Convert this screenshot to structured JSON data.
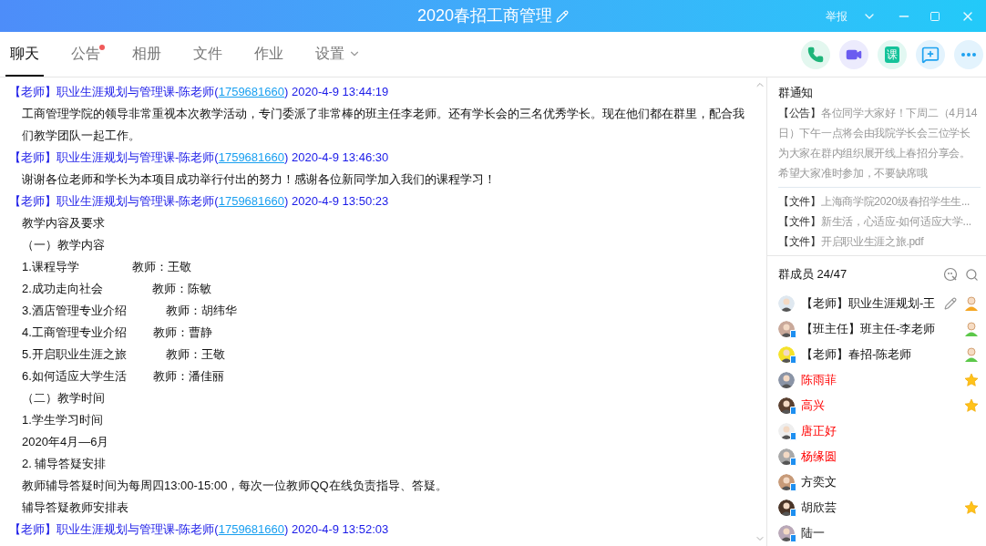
{
  "window": {
    "title": "2020春招工商管理",
    "report": "举报"
  },
  "tabs": [
    {
      "label": "聊天",
      "selected": true,
      "badge": false,
      "dropdown": false
    },
    {
      "label": "公告",
      "selected": false,
      "badge": true,
      "dropdown": false
    },
    {
      "label": "相册",
      "selected": false,
      "badge": false,
      "dropdown": false
    },
    {
      "label": "文件",
      "selected": false,
      "badge": false,
      "dropdown": false
    },
    {
      "label": "作业",
      "selected": false,
      "badge": false,
      "dropdown": false
    },
    {
      "label": "设置",
      "selected": false,
      "badge": false,
      "dropdown": true
    }
  ],
  "actions": [
    {
      "kind": "phone"
    },
    {
      "kind": "video"
    },
    {
      "kind": "lesson",
      "label": "课"
    },
    {
      "kind": "message"
    },
    {
      "kind": "more"
    }
  ],
  "messages": [
    {
      "role": "【老师】",
      "sender": "职业生涯规划与管理课-陈老师",
      "id": "1759681660",
      "time": "2020-4-9 13:44:19",
      "lines": [
        "工商管理学院的领导非常重视本次教学活动，专门委派了非常棒的班主任李老师。还有学长会的三名优秀学长。现在他们都在群里，配合我们教学团队一起工作。"
      ]
    },
    {
      "role": "【老师】",
      "sender": "职业生涯规划与管理课-陈老师",
      "id": "1759681660",
      "time": "2020-4-9 13:46:30",
      "lines": [
        "谢谢各位老师和学长为本项目成功举行付出的努力！感谢各位新同学加入我们的课程学习！"
      ]
    },
    {
      "role": "【老师】",
      "sender": "职业生涯规划与管理课-陈老师",
      "id": "1759681660",
      "time": "2020-4-9 13:50:23",
      "lines": [
        "教学内容及要求",
        "（一）教学内容",
        "1.课程导学                教师：王敬",
        "2.成功走向社会               教师：陈敏",
        "3.酒店管理专业介绍            教师：胡纬华",
        "4.工商管理专业介绍        教师：曹静",
        "5.开启职业生涯之旅            教师：王敬",
        "6.如何适应大学生活        教师：潘佳丽",
        "（二）教学时间",
        "1.学生学习时间",
        "2020年4月—6月",
        "2. 辅导答疑安排",
        "教师辅导答疑时间为每周四13:00-15:00，每次一位教师QQ在线负责指导、答疑。",
        "辅导答疑教师安排表"
      ]
    },
    {
      "role": "【老师】",
      "sender": "职业生涯规划与管理课-陈老师",
      "id": "1759681660",
      "time": "2020-4-9 13:52:03"
    }
  ],
  "id_brackets": {
    "open": "(",
    "close": ")"
  },
  "notices": {
    "title": "群通知",
    "items": [
      {
        "tag": "【公告】",
        "text": "各位同学大家好！下周二（4月14日）下午一点将会由我院学长会三位学长为大家在群内组织展开线上春招分享会。希望大家准时参加，不要缺席哦"
      },
      {
        "tag": "【文件】",
        "text": "上海商学院2020级春招学生生..."
      },
      {
        "tag": "【文件】",
        "text": "新生活，心适应-如何适应大学..."
      },
      {
        "tag": "【文件】",
        "text": "开启职业生涯之旅.pdf"
      }
    ]
  },
  "members": {
    "title": "群成员 24/47",
    "items": [
      {
        "name": "【老师】职业生涯规划-王",
        "highlighted": false,
        "kind": "owner",
        "mobile": false,
        "editable": true
      },
      {
        "name": "【班主任】班主任-李老师",
        "highlighted": false,
        "kind": "admin",
        "mobile": true,
        "editable": false
      },
      {
        "name": "【老师】春招-陈老师",
        "highlighted": false,
        "kind": "admin",
        "mobile": true,
        "editable": false
      },
      {
        "name": "陈雨菲",
        "highlighted": true,
        "kind": "star",
        "mobile": false,
        "editable": false
      },
      {
        "name": "高兴",
        "highlighted": true,
        "kind": "star",
        "mobile": true,
        "editable": false
      },
      {
        "name": "唐正好",
        "highlighted": true,
        "kind": "plain",
        "mobile": true,
        "editable": false
      },
      {
        "name": "杨缘圆",
        "highlighted": true,
        "kind": "plain",
        "mobile": true,
        "editable": false
      },
      {
        "name": "方奕文",
        "highlighted": false,
        "kind": "plain",
        "mobile": true,
        "editable": false
      },
      {
        "name": "胡欣芸",
        "highlighted": false,
        "kind": "star",
        "mobile": true,
        "editable": false
      },
      {
        "name": "陆一",
        "highlighted": false,
        "kind": "plain",
        "mobile": true,
        "editable": false
      }
    ]
  }
}
